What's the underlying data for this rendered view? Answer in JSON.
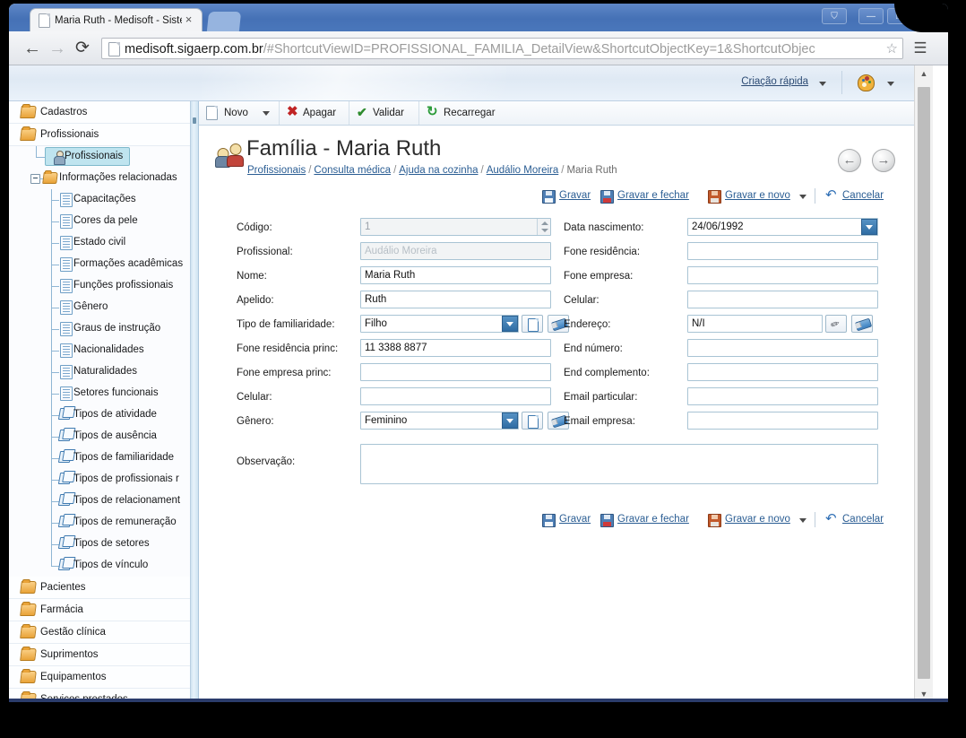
{
  "browser": {
    "tab_title": "Maria Ruth - Medisoft - Sister",
    "tab_close": "×",
    "url_bold": "medisoft.sigaerp.com.br",
    "url_rest": "/#ShortcutViewID=PROFISSIONAL_FAMILIA_DetailView&ShortcutObjectKey=1&ShortcutObjec",
    "back": "←",
    "forward": "→",
    "reload": "⟳",
    "star": "☆",
    "menu": "☰",
    "window_buttons": [
      "⛉",
      "—",
      "❐",
      "✕"
    ]
  },
  "app_top": {
    "quick_create": "Criação rápida"
  },
  "sidebar": {
    "modules_top": [
      {
        "label": "Cadastros",
        "icon": "folder-icon"
      },
      {
        "label": "Profissionais",
        "icon": "folder-icon"
      }
    ],
    "tree": [
      {
        "label": "Profissionais",
        "icon": "person-icon",
        "level": 1,
        "selected": true
      },
      {
        "label": "Informações relacionadas",
        "icon": "folder-icon",
        "level": 1,
        "expander": "minus"
      },
      {
        "label": "Capacitações",
        "icon": "document-icon",
        "level": 2
      },
      {
        "label": "Cores da pele",
        "icon": "document-icon",
        "level": 2
      },
      {
        "label": "Estado civil",
        "icon": "document-icon",
        "level": 2
      },
      {
        "label": "Formações acadêmicas",
        "icon": "document-icon",
        "level": 2
      },
      {
        "label": "Funções profissionais",
        "icon": "document-icon",
        "level": 2
      },
      {
        "label": "Gênero",
        "icon": "document-icon",
        "level": 2
      },
      {
        "label": "Graus de instrução",
        "icon": "document-icon",
        "level": 2
      },
      {
        "label": "Nacionalidades",
        "icon": "document-icon",
        "level": 2
      },
      {
        "label": "Naturalidades",
        "icon": "document-icon",
        "level": 2
      },
      {
        "label": "Setores funcionais",
        "icon": "document-icon",
        "level": 2
      },
      {
        "label": "Tipos de atividade",
        "icon": "stack-icon",
        "level": 2
      },
      {
        "label": "Tipos de ausência",
        "icon": "stack-icon",
        "level": 2
      },
      {
        "label": "Tipos de familiaridade",
        "icon": "stack-icon",
        "level": 2
      },
      {
        "label": "Tipos de profissionais r",
        "icon": "stack-icon",
        "level": 2
      },
      {
        "label": "Tipos de relacionament",
        "icon": "stack-icon",
        "level": 2
      },
      {
        "label": "Tipos de remuneração",
        "icon": "stack-icon",
        "level": 2
      },
      {
        "label": "Tipos de setores",
        "icon": "stack-icon",
        "level": 2
      },
      {
        "label": "Tipos de vínculo",
        "icon": "stack-icon",
        "level": 2
      }
    ],
    "modules_bottom": [
      {
        "label": "Pacientes",
        "icon": "folder-icon"
      },
      {
        "label": "Farmácia",
        "icon": "folder-icon"
      },
      {
        "label": "Gestão clínica",
        "icon": "folder-icon"
      },
      {
        "label": "Suprimentos",
        "icon": "folder-icon"
      },
      {
        "label": "Equipamentos",
        "icon": "folder-icon"
      },
      {
        "label": "Serviços prestados",
        "icon": "folder-icon"
      }
    ]
  },
  "commandbar": [
    {
      "label": "Novo",
      "icon": "new-page-icon",
      "has_caret": true
    },
    {
      "label": "Apagar",
      "icon": "delete-x-icon",
      "has_caret": false
    },
    {
      "label": "Validar",
      "icon": "check-icon",
      "has_caret": false
    },
    {
      "label": "Recarregar",
      "icon": "refresh-icon",
      "has_caret": false
    }
  ],
  "page": {
    "title": "Família - Maria Ruth",
    "breadcrumb": [
      {
        "label": "Profissionais",
        "link": true
      },
      {
        "label": "Consulta médica",
        "link": true
      },
      {
        "label": "Ajuda na cozinha",
        "link": true
      },
      {
        "label": "Audálio Moreira",
        "link": true
      },
      {
        "label": "Maria Ruth",
        "link": false
      }
    ],
    "breadcrumb_separator": "/",
    "nav_prev": "←",
    "nav_next": "→"
  },
  "actions": [
    {
      "label": "Gravar",
      "icon": "save-icon"
    },
    {
      "label": "Gravar e fechar",
      "icon": "save-close-icon"
    },
    {
      "label": "Gravar e novo",
      "icon": "save-new-icon",
      "has_caret": true
    },
    {
      "label": "Cancelar",
      "icon": "undo-icon"
    }
  ],
  "form": {
    "left": [
      {
        "label": "Código:",
        "value": "1",
        "type": "spinner",
        "readonly": true
      },
      {
        "label": "Profissional:",
        "value": "Audálio Moreira",
        "type": "text",
        "readonly": true,
        "placeholder_style": true
      },
      {
        "label": "Nome:",
        "value": "Maria Ruth",
        "type": "text"
      },
      {
        "label": "Apelido:",
        "value": "Ruth",
        "type": "text"
      },
      {
        "label": "Tipo de familiaridade:",
        "value": "Filho",
        "type": "lookup"
      },
      {
        "label": "Fone residência princ:",
        "value": "11 3388 8877",
        "type": "text"
      },
      {
        "label": "Fone empresa princ:",
        "value": "",
        "type": "text"
      },
      {
        "label": "Celular:",
        "value": "",
        "type": "text"
      },
      {
        "label": "Gênero:",
        "value": "Feminino",
        "type": "lookup"
      }
    ],
    "right": [
      {
        "label": "Data nascimento:",
        "value": "24/06/1992",
        "type": "date"
      },
      {
        "label": "Fone residência:",
        "value": "",
        "type": "text"
      },
      {
        "label": "Fone empresa:",
        "value": "",
        "type": "text"
      },
      {
        "label": "Celular:",
        "value": "",
        "type": "text"
      },
      {
        "label": "Endereço:",
        "value": "N/I",
        "type": "lookup2"
      },
      {
        "label": "End número:",
        "value": "",
        "type": "text"
      },
      {
        "label": "End complemento:",
        "value": "",
        "type": "text"
      },
      {
        "label": "Email particular:",
        "value": "",
        "type": "text"
      },
      {
        "label": "Email empresa:",
        "value": "",
        "type": "text"
      }
    ],
    "observacao": {
      "label": "Observação:",
      "value": ""
    }
  }
}
